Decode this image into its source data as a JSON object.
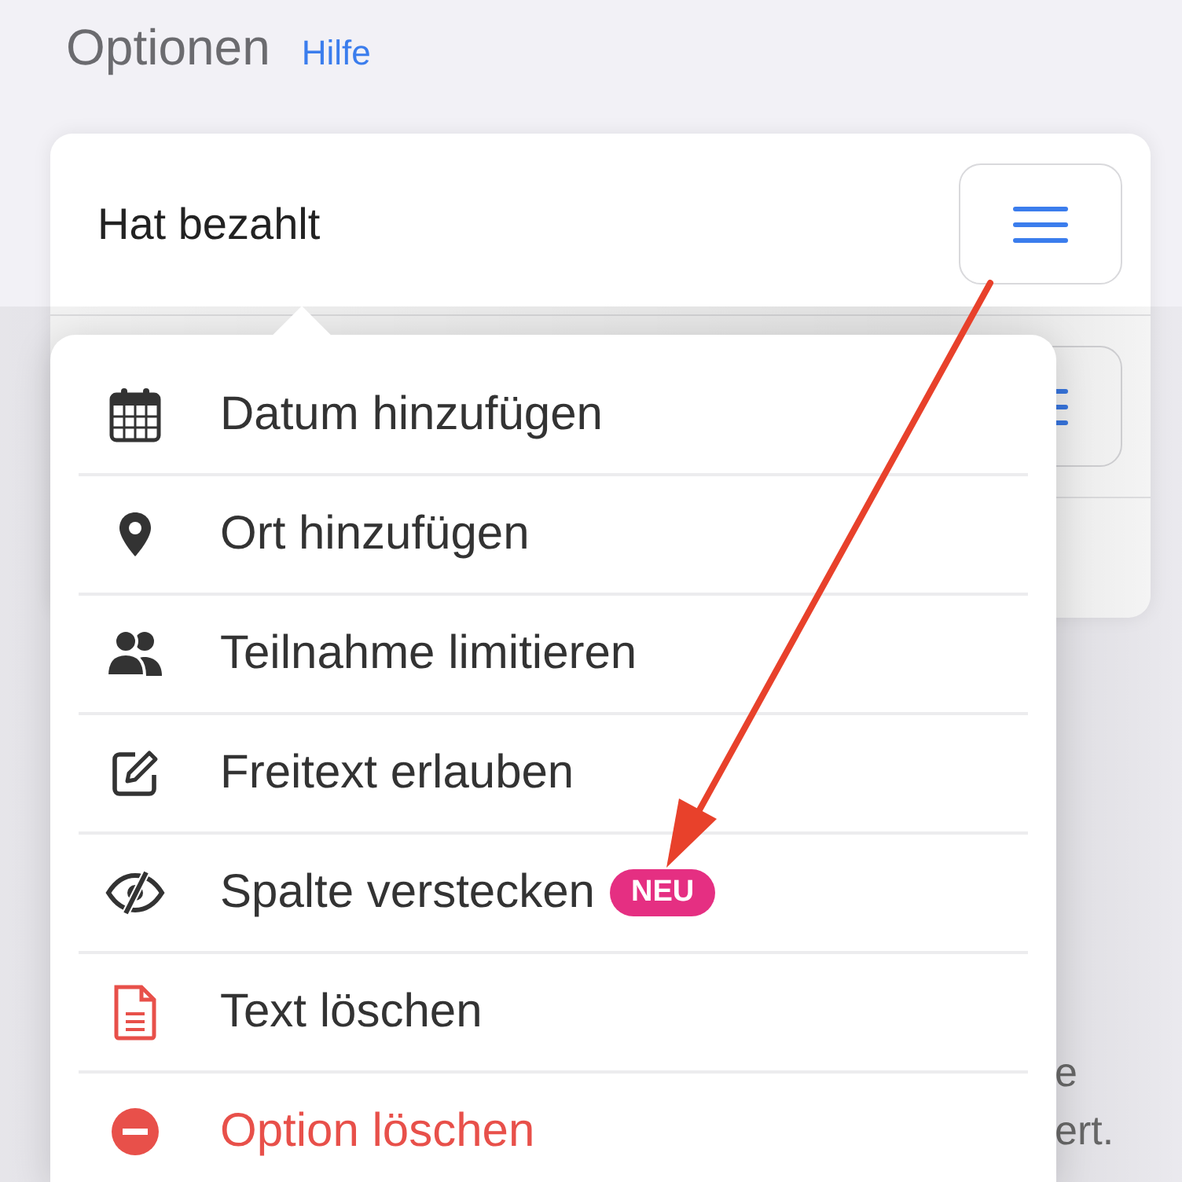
{
  "header": {
    "title": "Optionen",
    "help_link": "Hilfe"
  },
  "card": {
    "rows": [
      {
        "label": "Hat bezahlt"
      },
      {}
    ]
  },
  "note": {
    "lines": [
      "e",
      "ert."
    ]
  },
  "menu": {
    "items": [
      {
        "label": "Datum hinzufügen",
        "kind": "normal"
      },
      {
        "label": "Ort hinzufügen",
        "kind": "normal"
      },
      {
        "label": "Teilnahme limitieren",
        "kind": "normal"
      },
      {
        "label": "Freitext erlauben",
        "kind": "normal"
      },
      {
        "label": "Spalte verstecken",
        "kind": "normal",
        "badge": "NEU"
      },
      {
        "label": "Text löschen",
        "kind": "normal"
      },
      {
        "label": "Option löschen",
        "kind": "danger"
      }
    ]
  }
}
